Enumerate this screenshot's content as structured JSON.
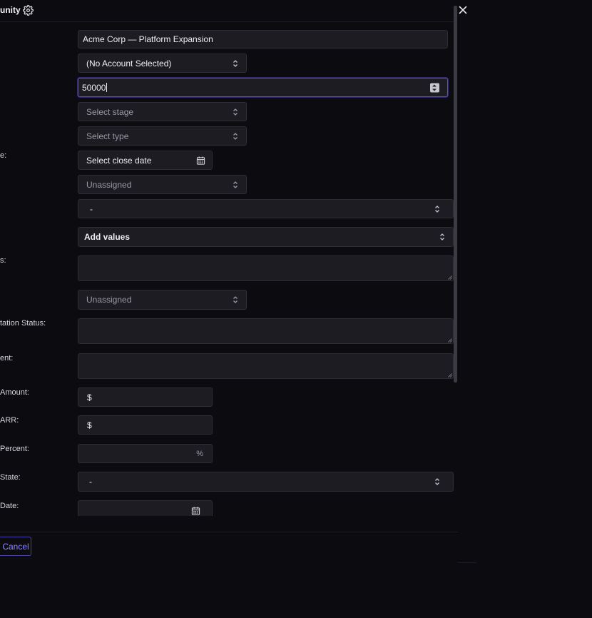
{
  "header": {
    "title": "unity"
  },
  "form": {
    "name_value": "Acme Corp — Platform Expansion",
    "account_value": "(No Account Selected)",
    "amount_value": "50000",
    "stage_placeholder": "Select stage",
    "type_placeholder": "Select type",
    "close_date_label": "e:",
    "close_date_placeholder": "Select close date",
    "owner_value": "Unassigned",
    "dash_select_1": "-",
    "add_values_label": "Add values",
    "notes_label": "s:",
    "assignee_value": "Unassigned",
    "implementation_status_label": "tation Status:",
    "ent_label": "ent:",
    "amount2_label": "Amount:",
    "amount2_prefix": "$",
    "arr_label": "ARR:",
    "arr_prefix": "$",
    "percent_label": "Percent:",
    "percent_suffix": "%",
    "state_label": "State:",
    "state_value": "-",
    "date_label": "Date:"
  },
  "footer": {
    "cancel_label": "Cancel"
  },
  "colors": {
    "accent": "#5b50c8",
    "cancel_text": "#8f86ff",
    "background": "#0b0b10",
    "field": "#1c1c22"
  }
}
